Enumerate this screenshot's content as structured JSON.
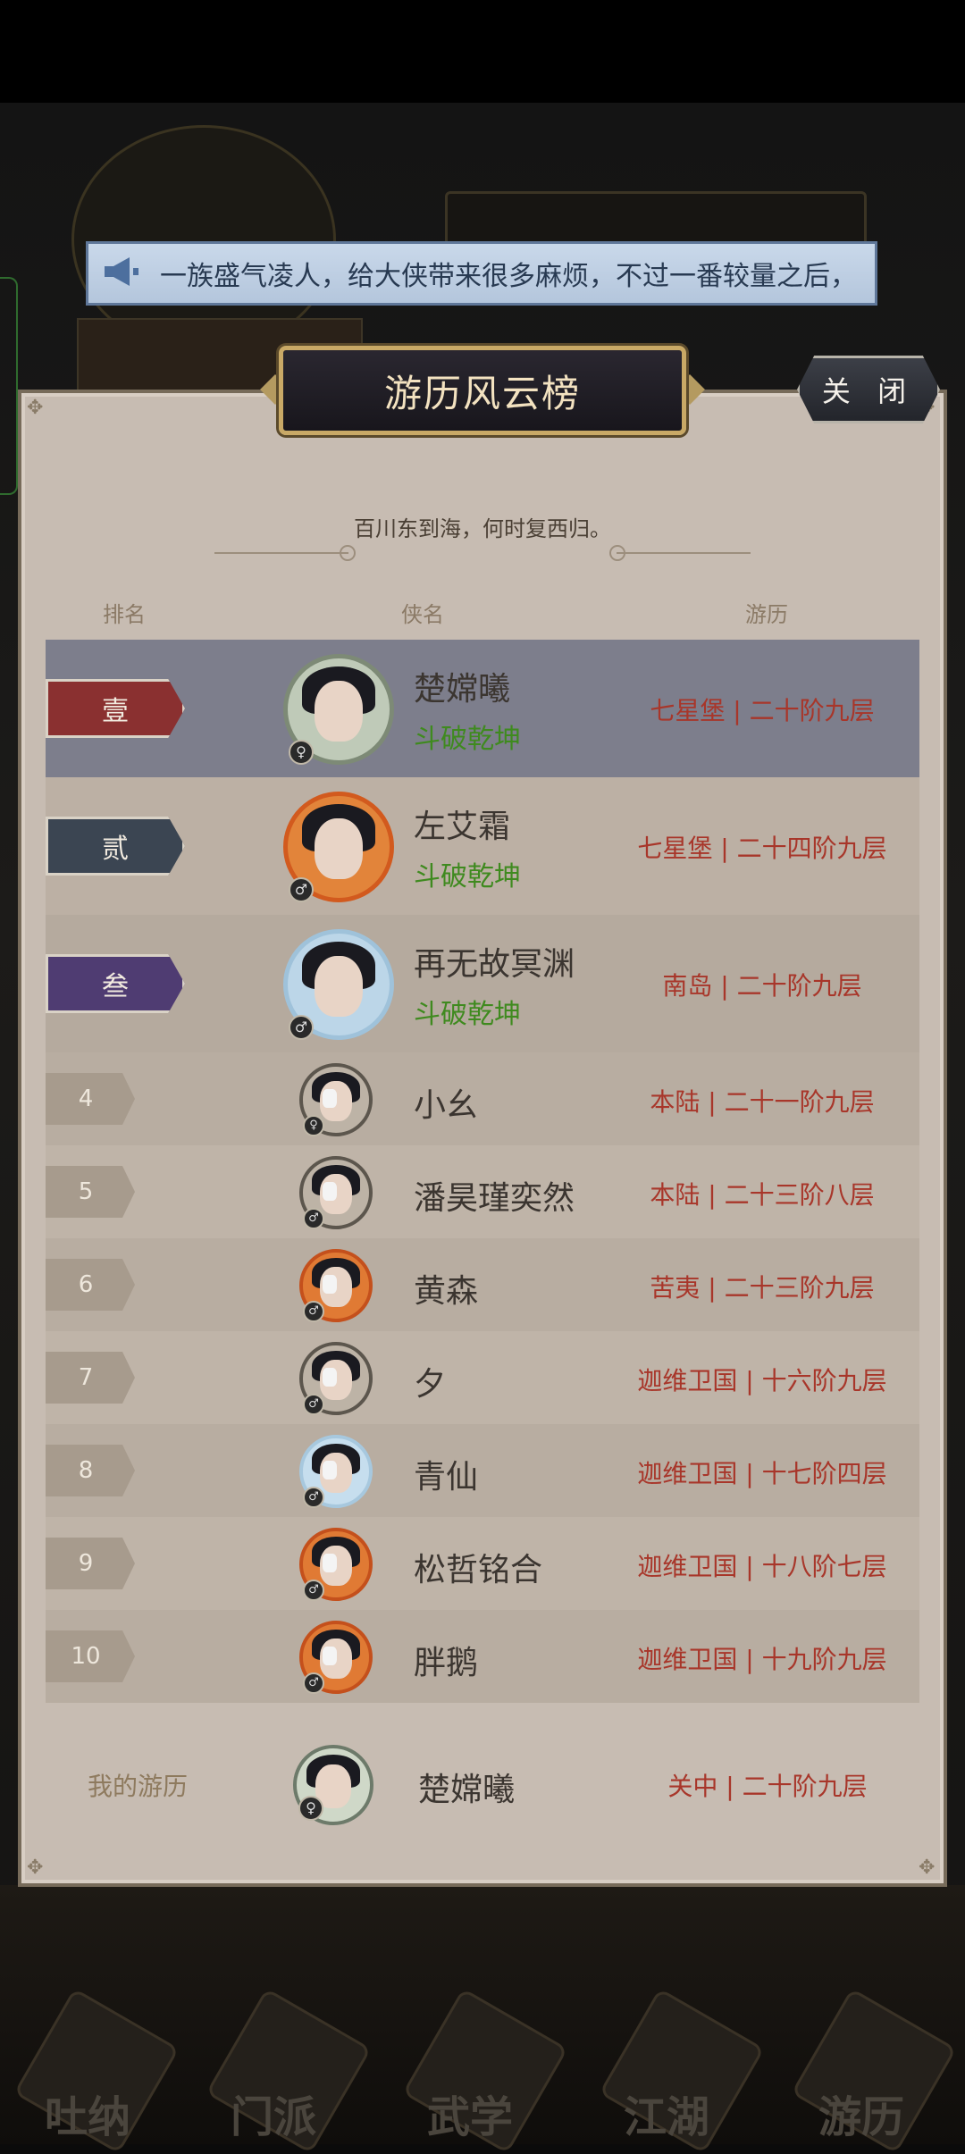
{
  "marquee": {
    "text": "一族盛气凌人，给大侠带来很多麻烦，不过一番较量之后，"
  },
  "dialog": {
    "title": "游历风云榜",
    "close_label": "关 闭",
    "subtitle": "百川东到海，何时复西归。"
  },
  "columns": {
    "rank": "排名",
    "name": "侠名",
    "travel": "游历"
  },
  "top3": [
    {
      "rank": "壹",
      "name": "楚嫦曦",
      "title": "斗破乾坤",
      "travel": "七星堡 | 二十阶九层",
      "rank_color": "#8a3030",
      "row_bg": "#7d7e8c",
      "gender": "♀"
    },
    {
      "rank": "贰",
      "name": "左艾霜",
      "title": "斗破乾坤",
      "travel": "七星堡 | 二十四阶九层",
      "rank_color": "#3b4552",
      "row_bg": "#bcb0a4",
      "gender": "♂"
    },
    {
      "rank": "叁",
      "name": "再无故冥渊",
      "title": "斗破乾坤",
      "travel": "南岛 | 二十阶九层",
      "rank_color": "#4f3c72",
      "row_bg": "#b5aa9e",
      "gender": "♂"
    }
  ],
  "others": [
    {
      "rank": "4",
      "name": "小幺",
      "travel": "本陆 | 二十一阶九层",
      "gender": "♀",
      "frame": "plain"
    },
    {
      "rank": "5",
      "name": "潘昊瑾奕然",
      "travel": "本陆 | 二十三阶八层",
      "gender": "♂",
      "frame": "plain"
    },
    {
      "rank": "6",
      "name": "黄森",
      "travel": "苦夷 | 二十三阶九层",
      "gender": "♂",
      "frame": "fire"
    },
    {
      "rank": "7",
      "name": "夕",
      "travel": "迦维卫国 | 十六阶九层",
      "gender": "♂",
      "frame": "plain"
    },
    {
      "rank": "8",
      "name": "青仙",
      "travel": "迦维卫国 | 十七阶四层",
      "gender": "♂",
      "frame": "ice"
    },
    {
      "rank": "9",
      "name": "松哲铭合",
      "travel": "迦维卫国 | 十八阶七层",
      "gender": "♂",
      "frame": "fire"
    },
    {
      "rank": "10",
      "name": "胖鹅",
      "travel": "迦维卫国 | 十九阶九层",
      "gender": "♂",
      "frame": "fire"
    }
  ],
  "mine": {
    "label": "我的游历",
    "name": "楚嫦曦",
    "travel": "关中 | 二十阶九层",
    "gender": "♀"
  },
  "bottom_nav": [
    "吐纳",
    "门派",
    "武学",
    "江湖",
    "游历"
  ],
  "colors": {
    "travel_text": "#a8362a",
    "title_green": "#3f8a1f",
    "dialog_bg": "#c7bcb2"
  }
}
